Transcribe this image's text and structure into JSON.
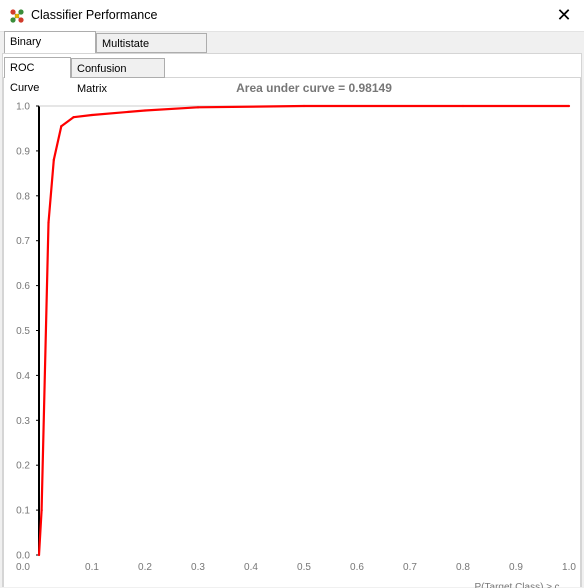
{
  "window": {
    "title": "Classifier Performance",
    "close_label": "✕"
  },
  "tabs": [
    {
      "label": "Binary Classifiers",
      "active": true
    },
    {
      "label": "Multistate Classifiers",
      "active": false
    }
  ],
  "subtabs": [
    {
      "label": "ROC Curve",
      "active": true
    },
    {
      "label": "Confusion Matrix",
      "active": false
    }
  ],
  "chart_data": {
    "type": "line",
    "title": "Area under curve = 0.98149",
    "xlabel": "P(Target Class) ≥ c",
    "ylabel": "",
    "xlim": [
      0,
      1
    ],
    "ylim": [
      0,
      1
    ],
    "x_ticks": [
      "0.0",
      "0.1",
      "0.2",
      "0.3",
      "0.4",
      "0.5",
      "0.6",
      "0.7",
      "0.8",
      "0.9",
      "1.0"
    ],
    "y_ticks": [
      "0.0",
      "0.1",
      "0.2",
      "0.3",
      "0.4",
      "0.5",
      "0.6",
      "0.7",
      "0.8",
      "0.9",
      "1.0"
    ],
    "grid": false,
    "series": [
      {
        "color": "#ff0000",
        "points": [
          [
            0.0,
            0.0
          ],
          [
            0.005,
            0.1
          ],
          [
            0.018,
            0.74
          ],
          [
            0.028,
            0.88
          ],
          [
            0.042,
            0.955
          ],
          [
            0.065,
            0.975
          ],
          [
            0.1,
            0.98
          ],
          [
            0.2,
            0.99
          ],
          [
            0.3,
            0.997
          ],
          [
            0.5,
            1.0
          ],
          [
            0.8,
            1.0
          ],
          [
            1.0,
            1.0
          ]
        ]
      }
    ]
  },
  "colors": {
    "line": "#ff0000",
    "axis": "#000000",
    "tick_text": "#777777",
    "title_text": "#777777"
  }
}
